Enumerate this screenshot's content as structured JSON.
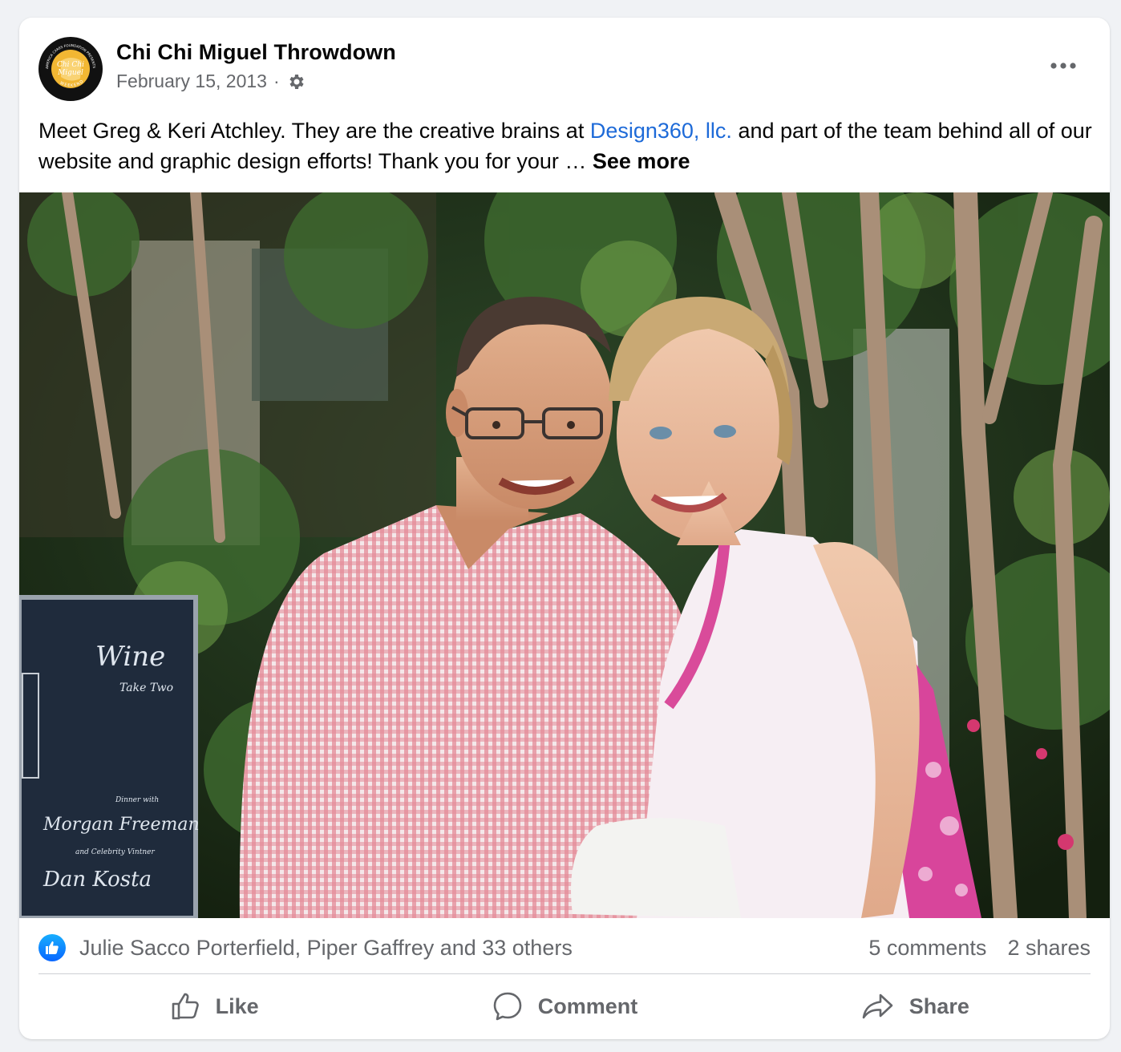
{
  "post": {
    "page_name": "Chi Chi Miguel Throwdown",
    "date": "February 15, 2013",
    "separator": "·",
    "privacy_icon": "gear-icon",
    "text_before_link": "Meet Greg & Keri Atchley. They are the creative brains at ",
    "link_text": "Design360, llc.",
    "text_after_link": " and part of the team behind all of our website and graphic design efforts! Thank you for your … ",
    "see_more": "See more",
    "photo_sign_text": [
      "Wine",
      "Take Two",
      "Dinner with",
      "Morgan Freeman",
      "and Celebrity Vintner",
      "Dan Kosta"
    ]
  },
  "avatar_logo": {
    "ring_text_top": "AMERICA CARES FOUNDATION PRESENTS",
    "center_text": "Chi Chi Miguel",
    "ring_text_bottom": "WEEKEND"
  },
  "reactions": {
    "reaction_icon": "like-icon",
    "names": "Julie Sacco Porterfield, Piper Gaffrey and 33 others",
    "comments": "5 comments",
    "shares": "2 shares"
  },
  "actions": {
    "like": "Like",
    "comment": "Comment",
    "share": "Share"
  },
  "colors": {
    "link": "#1d6ad8",
    "muted": "#65676b",
    "like_blue": "#0866ff"
  }
}
